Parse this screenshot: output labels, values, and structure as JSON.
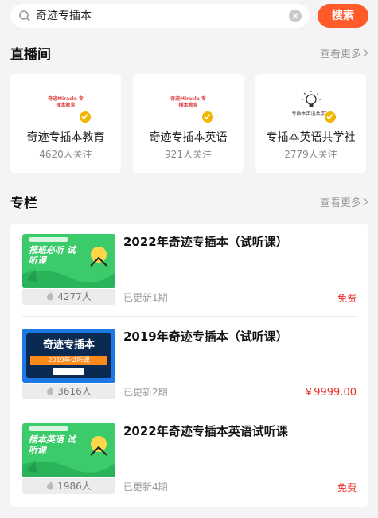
{
  "search": {
    "query": "奇迹专插本",
    "button_label": "搜索"
  },
  "live": {
    "title": "直播间",
    "more_label": "查看更多",
    "cards": [
      {
        "name": "奇迹专插本教育",
        "followers": "4620人关注",
        "logo_text": "奇迹Miracle 专插本教育"
      },
      {
        "name": "奇迹专插本英语",
        "followers": "921人关注",
        "logo_text": "奇迹Miracle 专插本教育"
      },
      {
        "name": "专插本英语共学社",
        "followers": "2779人关注",
        "logo_text": "专插本英语共学社"
      }
    ]
  },
  "column": {
    "title": "专栏",
    "more_label": "查看更多",
    "courses": [
      {
        "title": "2022年奇迹专插本（试听课）",
        "learners": "4277人",
        "updated": "已更新1期",
        "price": "免费",
        "thumb_text": "报班必听 试听课"
      },
      {
        "title": "2019年奇迹专插本（试听课）",
        "learners": "3616人",
        "updated": "已更新2期",
        "price": "￥9999.00",
        "thumb_text": "奇迹专插本",
        "thumb_sub": "2019年试听课"
      },
      {
        "title": "2022年奇迹专插本英语试听课",
        "learners": "1986人",
        "updated": "已更新4期",
        "price": "免费",
        "thumb_text": "插本英语 试听课"
      }
    ]
  },
  "colors": {
    "accent": "#ff5a2a",
    "price_red": "#e9302a",
    "verify_gold": "#f2b600"
  }
}
